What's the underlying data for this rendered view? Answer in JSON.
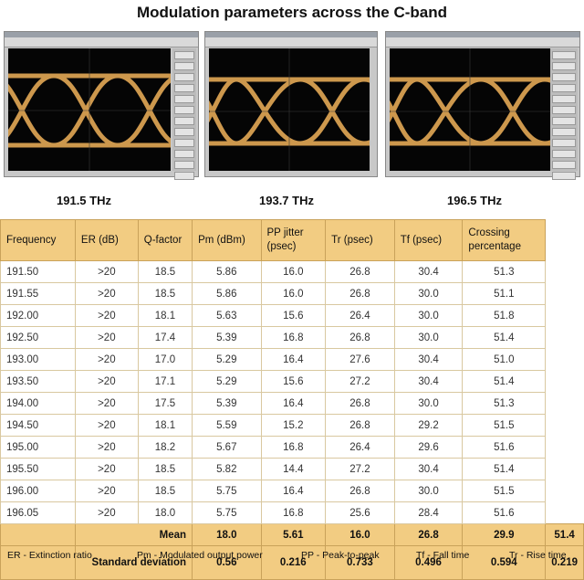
{
  "title": "Modulation parameters across the C-band",
  "eye_labels": [
    "191.5 THz",
    "193.7 THz",
    "196.5 THz"
  ],
  "table": {
    "headers": [
      "Frequency",
      "ER (dB)",
      "Q-factor",
      "Pm (dBm)",
      "PP jitter (psec)",
      "Tr (psec)",
      "Tf (psec)",
      "Crossing percentage"
    ],
    "rows": [
      [
        "191.50",
        ">20",
        "18.5",
        "5.86",
        "16.0",
        "26.8",
        "30.4",
        "51.3"
      ],
      [
        "191.55",
        ">20",
        "18.5",
        "5.86",
        "16.0",
        "26.8",
        "30.0",
        "51.1"
      ],
      [
        "192.00",
        ">20",
        "18.1",
        "5.63",
        "15.6",
        "26.4",
        "30.0",
        "51.8"
      ],
      [
        "192.50",
        ">20",
        "17.4",
        "5.39",
        "16.8",
        "26.8",
        "30.0",
        "51.4"
      ],
      [
        "193.00",
        ">20",
        "17.0",
        "5.29",
        "16.4",
        "27.6",
        "30.4",
        "51.0"
      ],
      [
        "193.50",
        ">20",
        "17.1",
        "5.29",
        "15.6",
        "27.2",
        "30.4",
        "51.4"
      ],
      [
        "194.00",
        ">20",
        "17.5",
        "5.39",
        "16.4",
        "26.8",
        "30.0",
        "51.3"
      ],
      [
        "194.50",
        ">20",
        "18.1",
        "5.59",
        "15.2",
        "26.8",
        "29.2",
        "51.5"
      ],
      [
        "195.00",
        ">20",
        "18.2",
        "5.67",
        "16.8",
        "26.4",
        "29.6",
        "51.6"
      ],
      [
        "195.50",
        ">20",
        "18.5",
        "5.82",
        "14.4",
        "27.2",
        "30.4",
        "51.4"
      ],
      [
        "196.00",
        ">20",
        "18.5",
        "5.75",
        "16.4",
        "26.8",
        "30.0",
        "51.5"
      ],
      [
        "196.05",
        ">20",
        "18.0",
        "5.75",
        "16.8",
        "25.6",
        "28.4",
        "51.6"
      ]
    ],
    "summary": [
      {
        "label": "Mean",
        "values": [
          "18.0",
          "5.61",
          "16.0",
          "26.8",
          "29.9",
          "51.4"
        ]
      },
      {
        "label": "Standard deviation",
        "values": [
          "0.56",
          "0.216",
          "0.733",
          "0.496",
          "0.594",
          "0.219"
        ]
      }
    ]
  },
  "legend": [
    "ER - Extinction ratio",
    "Pm - Modulated output power",
    "PP - Peak-to-peak",
    "Tf - Fall time",
    "Tr - Rise time"
  ],
  "colors": {
    "header_bg": "#f2cc82",
    "eye_trace": "#f0b25a",
    "screen_bg": "#050505"
  }
}
